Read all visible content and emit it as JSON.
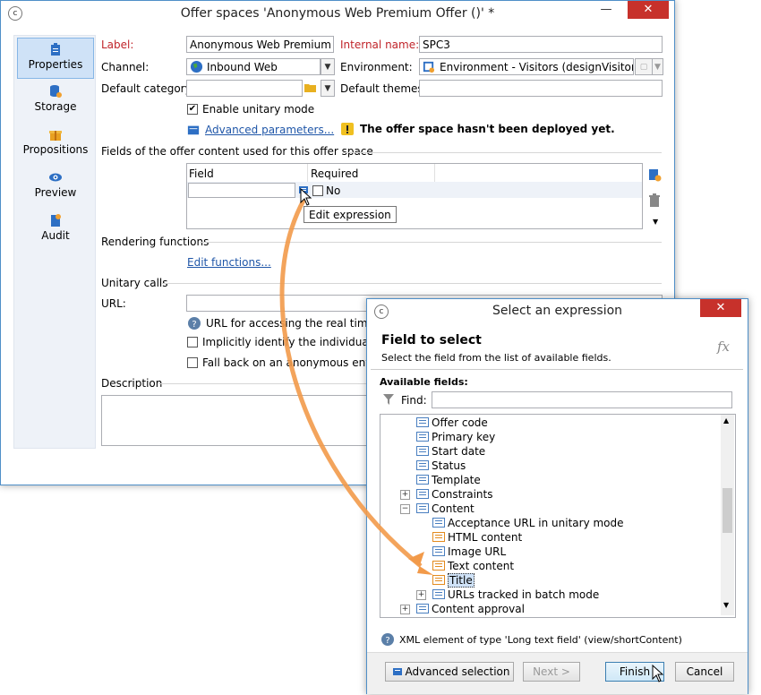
{
  "main": {
    "title": "Offer spaces 'Anonymous Web Premium Offer ()' *",
    "sidebar": [
      {
        "label": "Properties"
      },
      {
        "label": "Storage"
      },
      {
        "label": "Propositions"
      },
      {
        "label": "Preview"
      },
      {
        "label": "Audit"
      }
    ],
    "label_lbl": "Label:",
    "label_val": "Anonymous Web Premium Offer",
    "internal_lbl": "Internal name:",
    "internal_val": "SPC3",
    "channel_lbl": "Channel:",
    "channel_val": "Inbound Web",
    "env_lbl": "Environment:",
    "env_val": "Environment - Visitors (designVisitor)",
    "defcat_lbl": "Default category:",
    "defthemes_lbl": "Default themes:",
    "unitary_lbl": "Enable unitary mode",
    "unitary_checked": "✔",
    "advanced_link": "Advanced parameters...",
    "warning": "The offer space hasn't been deployed yet.",
    "fields_section": "Fields of the offer content used for this offer space",
    "col_field": "Field",
    "col_required": "Required",
    "row_required": "No",
    "tooltip": "Edit expression",
    "rendering_section": "Rendering functions",
    "edit_functions": "Edit functions...",
    "unitary_section": "Unitary calls",
    "url_lbl": "URL:",
    "url_help": "URL for accessing the real time we",
    "implicit_lbl": "Implicitly identify the individual ba",
    "fallback_lbl": "Fall back on an anonymous enviror",
    "description_section": "Description"
  },
  "dialog": {
    "title": "Select an expression",
    "heading": "Field to select",
    "subheading": "Select the field from the list of available fields.",
    "fx": "fx",
    "available": "Available fields:",
    "find_lbl": "Find:",
    "tree": [
      {
        "label": "Offer code"
      },
      {
        "label": "Primary key"
      },
      {
        "label": "Start date"
      },
      {
        "label": "Status"
      },
      {
        "label": "Template"
      },
      {
        "label": "Constraints"
      },
      {
        "label": "Content"
      },
      {
        "label": "Acceptance URL in unitary mode"
      },
      {
        "label": "HTML content"
      },
      {
        "label": "Image URL"
      },
      {
        "label": "Text content"
      },
      {
        "label": "Title"
      },
      {
        "label": "URLs tracked in batch mode"
      },
      {
        "label": "Content approval"
      }
    ],
    "info": "XML element of type 'Long text field' (view/shortContent)",
    "btn_advanced": "Advanced selection",
    "btn_next": "Next >",
    "btn_finish": "Finish",
    "btn_cancel": "Cancel"
  },
  "colors": {
    "accent": "#1f56a8",
    "close": "#c7312b",
    "arrow": "#f29a4a",
    "selection": "#cfe2f7"
  }
}
